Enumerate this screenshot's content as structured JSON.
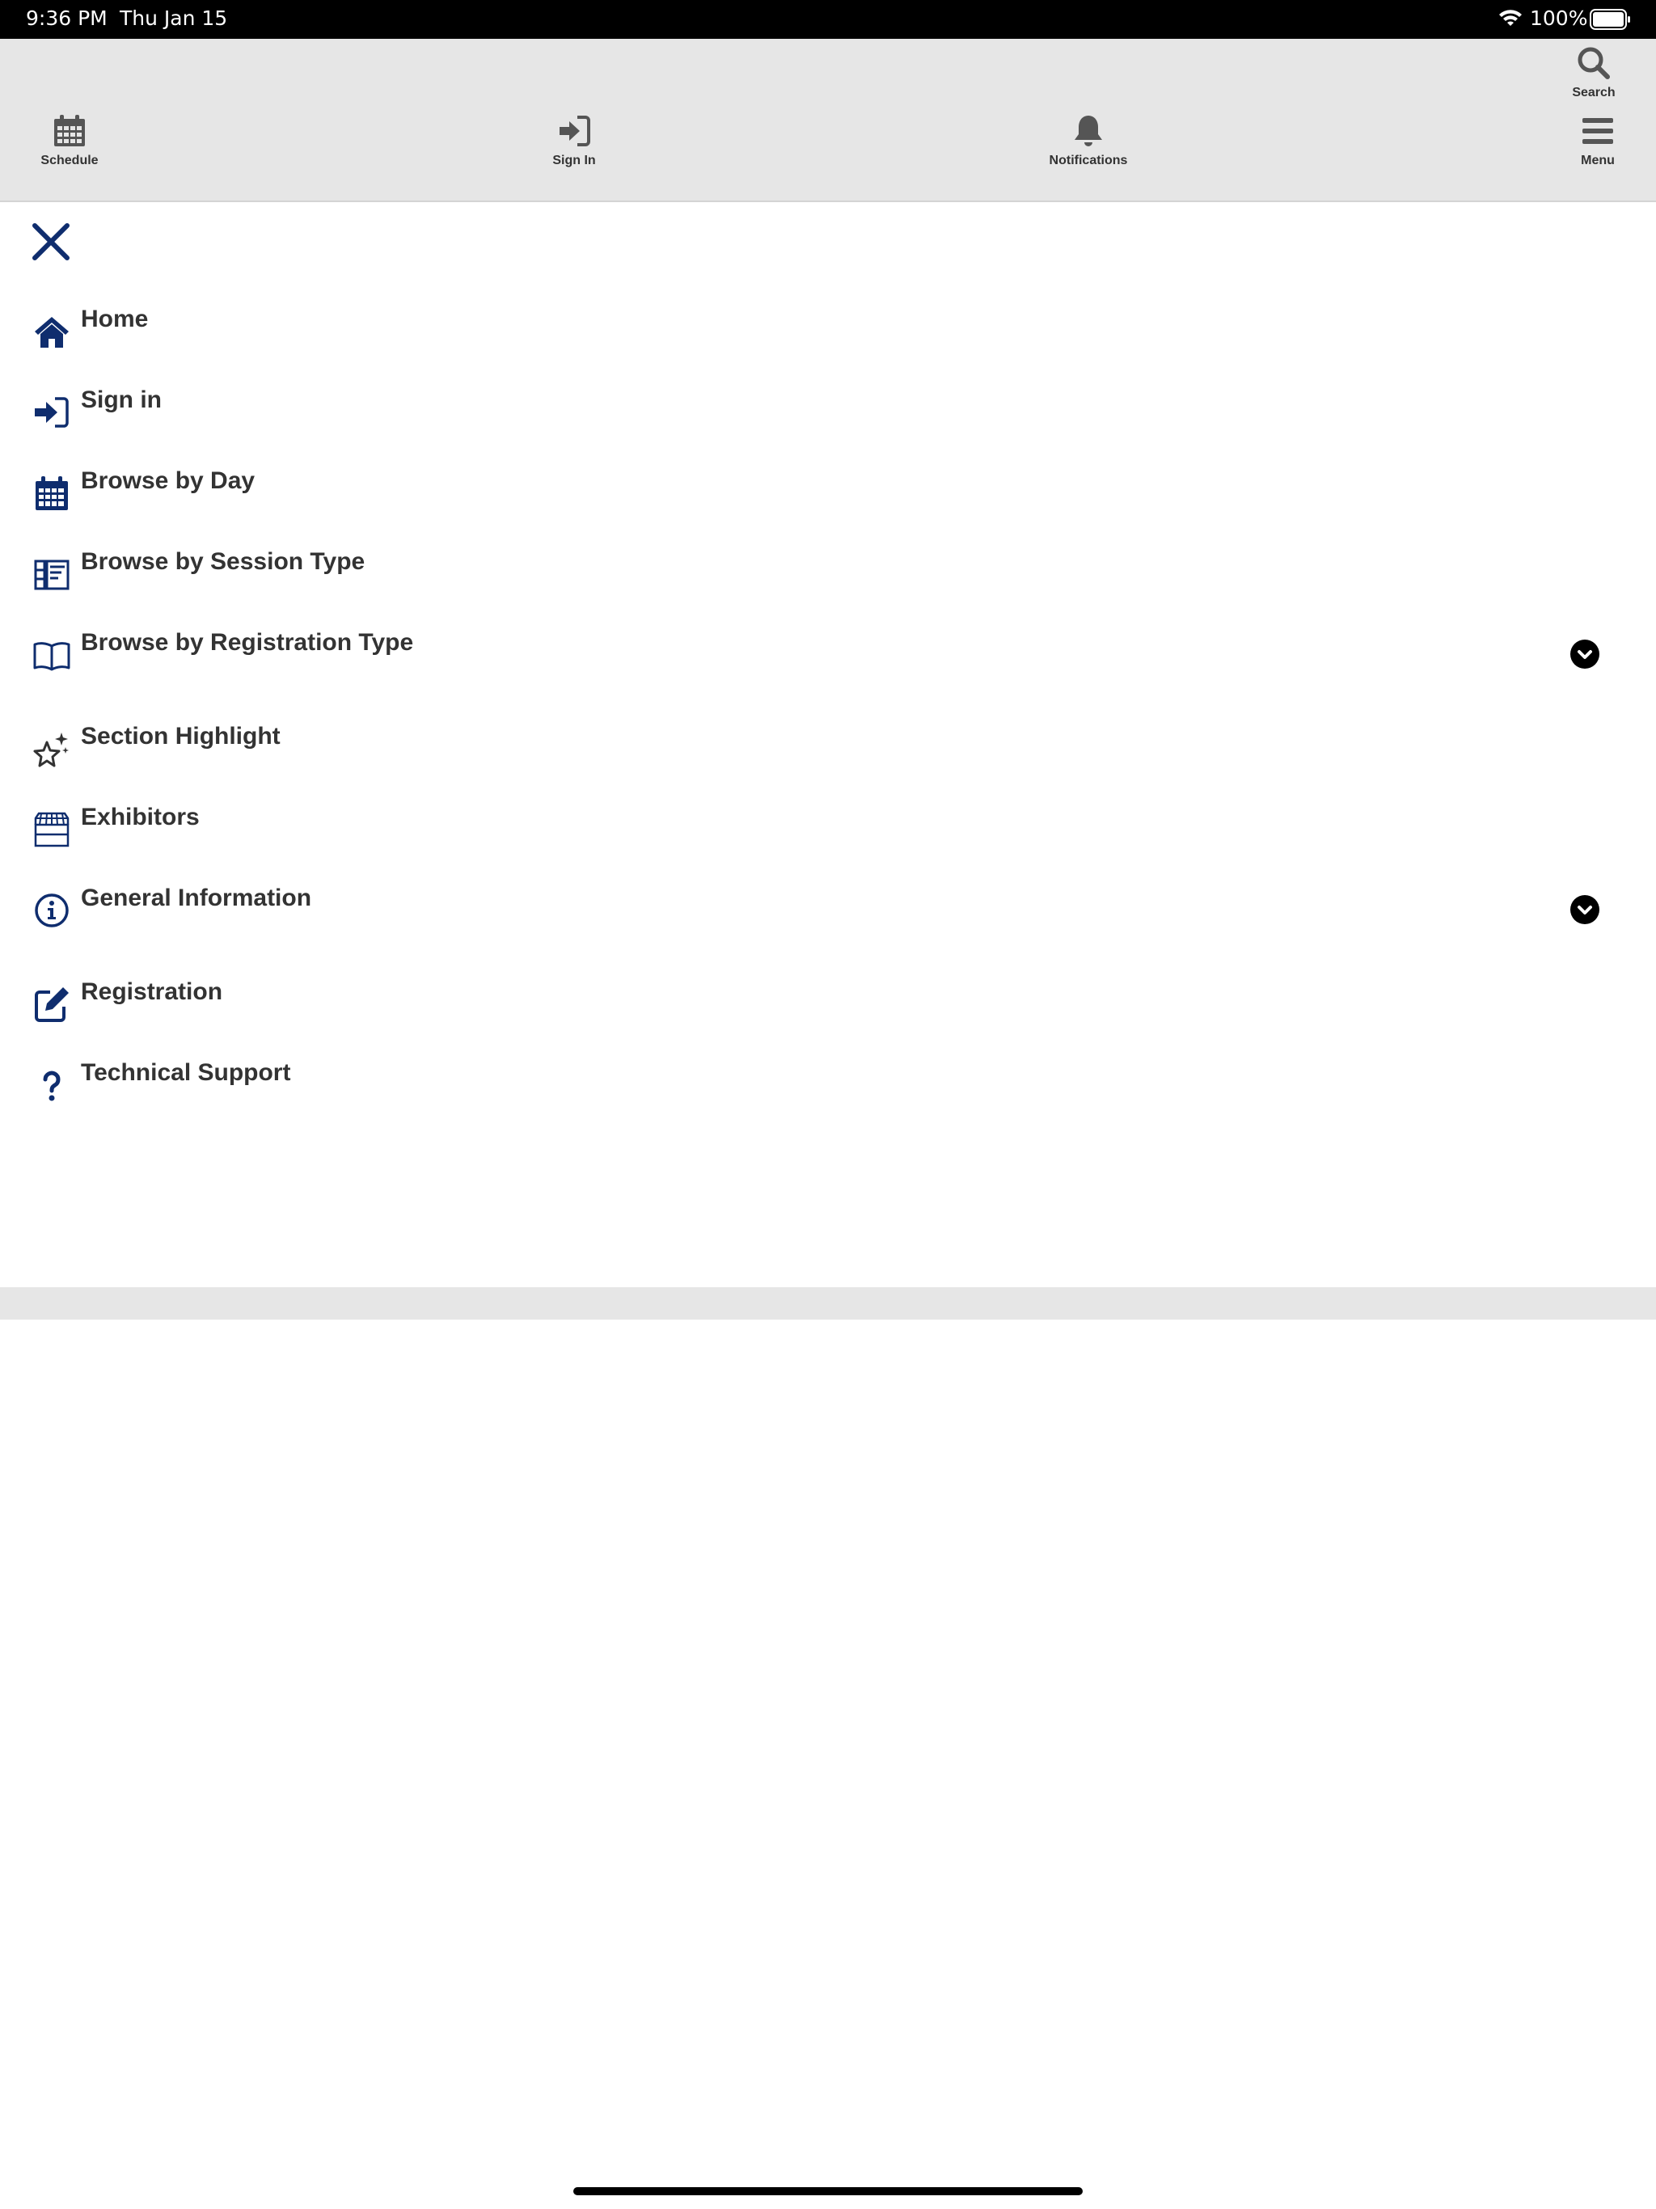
{
  "status_bar": {
    "time": "9:36 PM",
    "date": "Thu Jan 15",
    "battery": "100%"
  },
  "top_nav": {
    "items": [
      {
        "label": "Schedule",
        "icon": "calendar-icon"
      },
      {
        "label": "Sign In",
        "icon": "sign-in-icon"
      },
      {
        "label": "Notifications",
        "icon": "bell-icon"
      },
      {
        "label": "Search",
        "icon": "search-icon"
      },
      {
        "label": "Menu",
        "icon": "hamburger-icon"
      }
    ]
  },
  "side_menu": {
    "close_icon": "close-icon",
    "items": [
      {
        "label": "Home",
        "icon": "home-icon"
      },
      {
        "label": "Sign in",
        "icon": "sign-in-icon"
      },
      {
        "label": "Browse by Day",
        "icon": "calendar-icon"
      },
      {
        "label": "Browse by Session Type",
        "icon": "session-list-icon"
      },
      {
        "label": "Browse by Registration Type",
        "icon": "book-icon",
        "expandable": true
      },
      {
        "label": "Section Highlight",
        "icon": "sparkle-star-icon"
      },
      {
        "label": "Exhibitors",
        "icon": "storefront-icon"
      },
      {
        "label": "General Information",
        "icon": "info-icon",
        "expandable": true
      },
      {
        "label": "Registration",
        "icon": "edit-icon"
      },
      {
        "label": "Technical Support",
        "icon": "question-icon"
      }
    ]
  },
  "colors": {
    "accent": "#0f2d6e",
    "nav_background": "#e6e6e6",
    "text": "#333333",
    "nav_icon": "#555555"
  }
}
